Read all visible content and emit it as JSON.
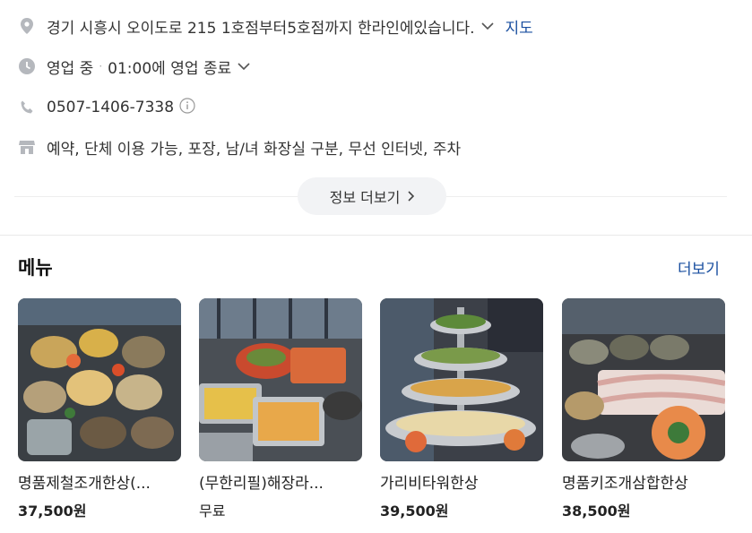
{
  "info": {
    "address": "경기 시흥시 오이도로 215 1호점부터5호점까지 한라인에있습니다.",
    "map_link": "지도",
    "hours_status": "영업 중",
    "hours_separator": "·",
    "hours_close": "01:00에 영업 종료",
    "phone": "0507-1406-7338",
    "amenities": "예약, 단체 이용 가능, 포장, 남/녀 화장실 구분, 무선 인터넷, 주차",
    "more_info_label": "정보 더보기"
  },
  "menu": {
    "title": "메뉴",
    "more_label": "더보기",
    "items": [
      {
        "name": "명품제철조개한상(...",
        "price": "37,500원"
      },
      {
        "name": "(무한리필)해장라...",
        "price": "무료"
      },
      {
        "name": "가리비타워한상",
        "price": "39,500원"
      },
      {
        "name": "명품키조개삼합한상",
        "price": "38,500원"
      }
    ]
  },
  "icons": {
    "address": "location-pin-icon",
    "hours": "clock-icon",
    "phone": "phone-icon",
    "amenities": "store-icon"
  }
}
